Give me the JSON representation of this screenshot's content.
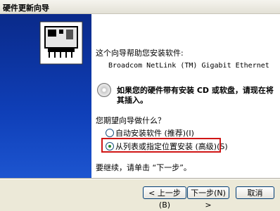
{
  "window": {
    "title": "硬件更新向导"
  },
  "content": {
    "intro": "这个向导帮助您安装软件:",
    "device_name": "Broadcom NetLink (TM) Gigabit Ethernet",
    "cd_prompt_line1": "如果您的硬件带有安装 CD 或软盘，请现在将",
    "cd_prompt_line2": "其插入。",
    "question": "您期望向导做什么？",
    "options": [
      {
        "label": "自动安装软件 (推荐)(I)",
        "selected": false
      },
      {
        "label": "从列表或指定位置安装 (高级)(S)",
        "selected": true
      }
    ],
    "continue_text": "要继续，请单击 “下一步”。"
  },
  "buttons": {
    "back": "< 上一步(B)",
    "next": "下一步(N) >",
    "cancel": "取消"
  }
}
